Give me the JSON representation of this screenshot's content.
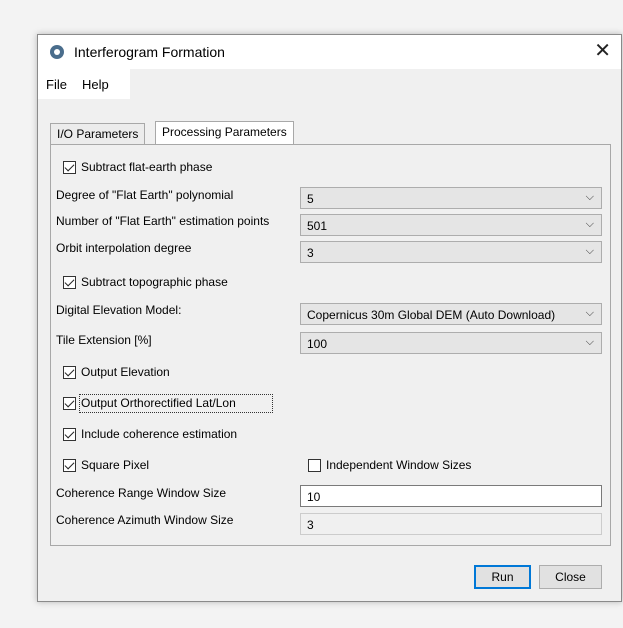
{
  "window": {
    "title": "Interferogram Formation",
    "close_glyph": "✕"
  },
  "menu": [
    "File",
    "Help"
  ],
  "tabs": [
    {
      "label": "I/O Parameters",
      "active": false
    },
    {
      "label": "Processing Parameters",
      "active": true
    }
  ],
  "params": {
    "subtract_flat_earth": {
      "label": "Subtract flat-earth phase",
      "checked": true
    },
    "degree_flat_earth": {
      "label": "Degree of \"Flat Earth\" polynomial",
      "value": "5"
    },
    "num_flat_earth_points": {
      "label": "Number of \"Flat Earth\" estimation points",
      "value": "501"
    },
    "orbit_degree": {
      "label": "Orbit interpolation degree",
      "value": "3"
    },
    "subtract_topo": {
      "label": "Subtract topographic phase",
      "checked": true
    },
    "dem": {
      "label": "Digital Elevation Model:",
      "value": "Copernicus 30m Global DEM (Auto Download)"
    },
    "tile_extension": {
      "label": "Tile Extension [%]",
      "value": "100"
    },
    "output_elevation": {
      "label": "Output Elevation",
      "checked": true
    },
    "output_ortho": {
      "label": "Output Orthorectified Lat/Lon",
      "checked": true
    },
    "include_coherence": {
      "label": "Include coherence estimation",
      "checked": true
    },
    "square_pixel": {
      "label": "Square Pixel",
      "checked": true
    },
    "independent_windows": {
      "label": "Independent Window Sizes",
      "checked": false
    },
    "coh_range": {
      "label": "Coherence Range Window Size",
      "value": "10"
    },
    "coh_azimuth": {
      "label": "Coherence Azimuth Window Size",
      "value": "3"
    }
  },
  "buttons": {
    "run": "Run",
    "close": "Close"
  },
  "icons": {
    "dropdown": "chevron-down-icon",
    "app": "app-logo-icon"
  },
  "colors": {
    "accent": "#0078d7",
    "window_bg": "#f0f0f0"
  }
}
